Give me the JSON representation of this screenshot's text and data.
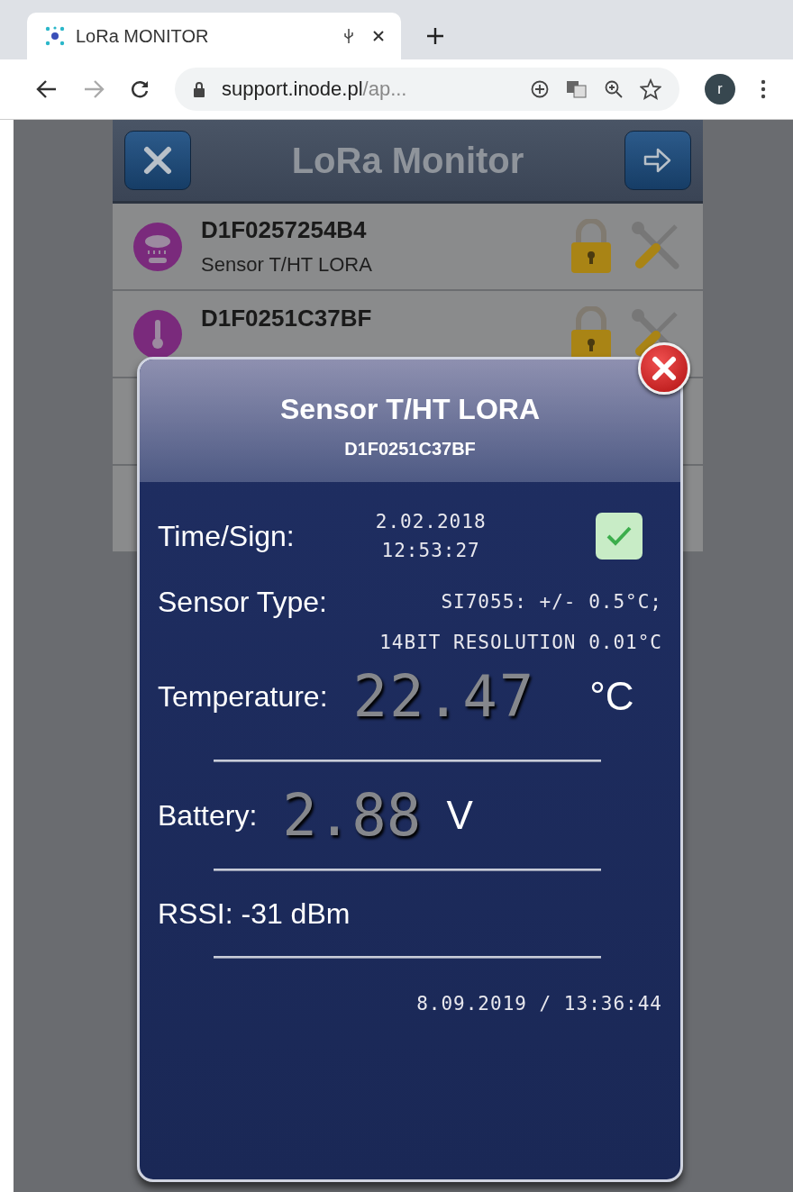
{
  "browser": {
    "tab": {
      "title": "LoRa MONITOR"
    },
    "address": {
      "domain": "support.inode.pl",
      "path": "/ap..."
    },
    "profile": "r"
  },
  "app": {
    "title": "LoRa Monitor"
  },
  "devices": [
    {
      "id": "D1F0257254B4",
      "type": "Sensor T/HT LORA",
      "kind": "weather"
    },
    {
      "id": "D1F0251C37BF",
      "kind": "thermometer"
    }
  ],
  "dialog": {
    "title": "Sensor T/HT LORA",
    "id": "D1F0251C37BF",
    "time_sign": {
      "label": "Time/Sign:",
      "date": "2.02.2018",
      "time": "12:53:27",
      "valid": true
    },
    "sensor_type": {
      "label": "Sensor Type:",
      "line_1": "SI7055: +/- 0.5°C;",
      "line_2": "14BIT RESOLUTION 0.01°C"
    },
    "temperature": {
      "label": "Temperature:",
      "value": "22.47",
      "unit": "°C"
    },
    "battery": {
      "label": "Battery:",
      "value": "2.88",
      "unit": "V"
    },
    "rssi": "RSSI: -31 dBm",
    "timestamp": "8.09.2019 / 13:36:44"
  }
}
